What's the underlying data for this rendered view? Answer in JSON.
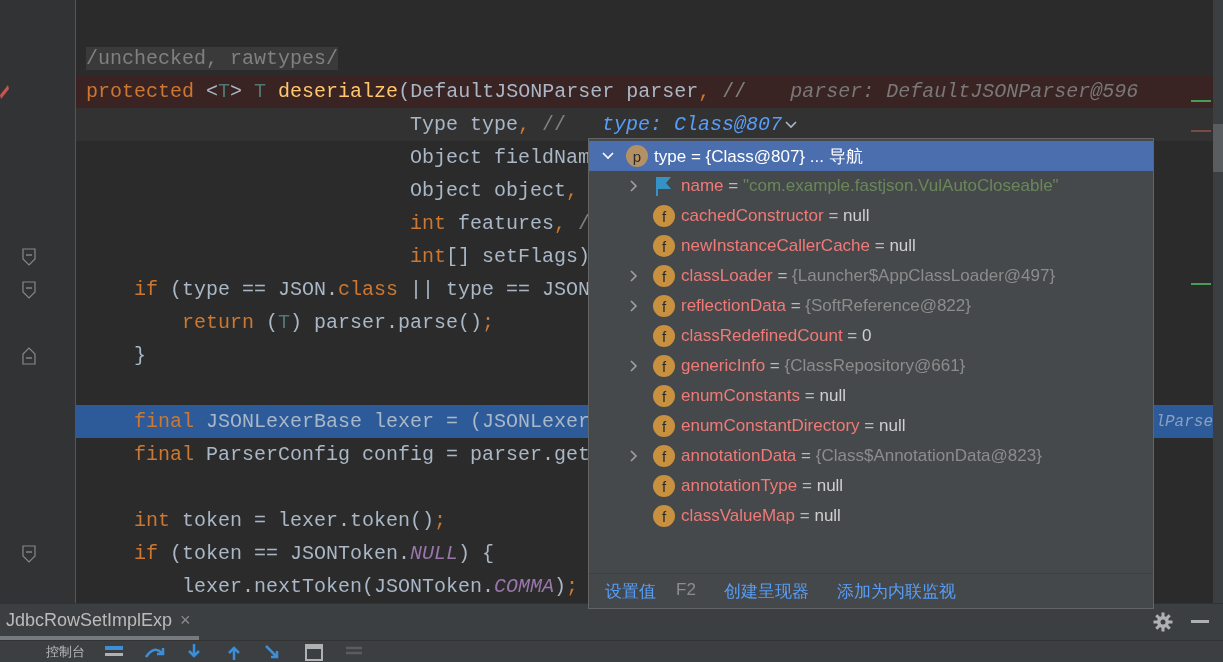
{
  "editor": {
    "gutter": [
      {
        "kind": "none"
      },
      {
        "kind": "breakpoint"
      },
      {
        "kind": "none"
      },
      {
        "kind": "none"
      },
      {
        "kind": "none"
      },
      {
        "kind": "none"
      },
      {
        "kind": "fold-start"
      },
      {
        "kind": "fold-start"
      },
      {
        "kind": "none"
      },
      {
        "kind": "fold-end"
      },
      {
        "kind": "none"
      },
      {
        "kind": "none"
      },
      {
        "kind": "none"
      },
      {
        "kind": "none"
      },
      {
        "kind": "none"
      },
      {
        "kind": "fold-start"
      },
      {
        "kind": "none"
      }
    ],
    "lines": [
      {
        "kind": "annotation",
        "tokens": [
          {
            "kind": "comment",
            "t": "/unchecked, rawtypes/"
          }
        ]
      },
      {
        "kind": "breakpoint",
        "tokens": [
          {
            "kind": "kw",
            "t": "protected"
          },
          {
            "kind": "plain",
            "t": " <"
          },
          {
            "kind": "tp",
            "t": "T"
          },
          {
            "kind": "plain",
            "t": "> "
          },
          {
            "kind": "tp",
            "t": "T"
          },
          {
            "kind": "fn",
            "t": " deserialze"
          },
          {
            "kind": "plain",
            "t": "(DefaultJSONParser parser"
          },
          {
            "kind": "punct",
            "t": ","
          },
          {
            "kind": "comment",
            "t": " //"
          }
        ],
        "hint": {
          "kind": "inline",
          "text": "parser: DefaultJSONParser@596"
        }
      },
      {
        "kind": "param-current",
        "tokens": [
          {
            "kind": "plain",
            "t": "Type type"
          },
          {
            "kind": "punct",
            "t": ","
          },
          {
            "kind": "comment",
            "t": " //"
          }
        ],
        "hint": {
          "kind": "dropdown",
          "text": "type: Class@807"
        }
      },
      {
        "kind": "param",
        "tokens": [
          {
            "kind": "plain",
            "t": "Object fieldNam"
          }
        ]
      },
      {
        "kind": "param",
        "tokens": [
          {
            "kind": "plain",
            "t": "Object object"
          },
          {
            "kind": "punct",
            "t": ","
          }
        ]
      },
      {
        "kind": "param",
        "tokens": [
          {
            "kind": "kw",
            "t": "int"
          },
          {
            "kind": "plain",
            "t": " features"
          },
          {
            "kind": "punct",
            "t": ","
          },
          {
            "kind": "comment",
            "t": " /"
          }
        ]
      },
      {
        "kind": "param",
        "tokens": [
          {
            "kind": "kw",
            "t": "int"
          },
          {
            "kind": "plain",
            "t": "[] setFlags)"
          }
        ]
      },
      {
        "kind": "block",
        "tokens": [
          {
            "kind": "kw",
            "t": "if"
          },
          {
            "kind": "plain",
            "t": " (type == JSON."
          },
          {
            "kind": "kw",
            "t": "class"
          },
          {
            "kind": "plain",
            "t": " || type == JSON"
          }
        ]
      },
      {
        "kind": "nested",
        "tokens": [
          {
            "kind": "kw",
            "t": "return"
          },
          {
            "kind": "plain",
            "t": " ("
          },
          {
            "kind": "tp",
            "t": "T"
          },
          {
            "kind": "plain",
            "t": ") parser.parse()"
          },
          {
            "kind": "punct",
            "t": ";"
          }
        ]
      },
      {
        "kind": "block",
        "tokens": [
          {
            "kind": "plain",
            "t": "}"
          }
        ]
      },
      {
        "kind": "block"
      },
      {
        "kind": "block-execution",
        "tokens": [
          {
            "kind": "kw",
            "t": "final"
          },
          {
            "kind": "plain",
            "t": " JSONLexerBase lexer = (JSONLexer"
          }
        ],
        "tail": "lParse"
      },
      {
        "kind": "block",
        "tokens": [
          {
            "kind": "kw",
            "t": "final"
          },
          {
            "kind": "plain",
            "t": " ParserConfig config = parser.get"
          }
        ]
      },
      {
        "kind": "block"
      },
      {
        "kind": "block",
        "tokens": [
          {
            "kind": "kw",
            "t": "int"
          },
          {
            "kind": "plain",
            "t": " token = lexer.token()"
          },
          {
            "kind": "punct",
            "t": ";"
          }
        ]
      },
      {
        "kind": "block",
        "tokens": [
          {
            "kind": "kw",
            "t": "if"
          },
          {
            "kind": "plain",
            "t": " (token == JSONToken."
          },
          {
            "kind": "const",
            "t": "NULL"
          },
          {
            "kind": "plain",
            "t": ") {"
          }
        ]
      },
      {
        "kind": "nested",
        "tokens": [
          {
            "kind": "plain",
            "t": "lexer.nextToken(JSONToken."
          },
          {
            "kind": "const",
            "t": "COMMA"
          },
          {
            "kind": "plain",
            "t": ")"
          },
          {
            "kind": "punct",
            "t": ";"
          }
        ]
      }
    ]
  },
  "popup": {
    "header": {
      "expanded": true,
      "selected": true,
      "badge": "p",
      "name": "type",
      "op": "=",
      "value": "{Class@807}",
      "suffix": "... 导航"
    },
    "rows": [
      {
        "expandable": true,
        "kind": "string",
        "icon": {
          "kind": "flag"
        },
        "name": "name",
        "op": "=",
        "value": "\"com.example.fastjson.VulAutoCloseable\""
      },
      {
        "expandable": false,
        "kind": "plain",
        "icon": {
          "kind": "letter",
          "letter": "f"
        },
        "name": "cachedConstructor",
        "op": "=",
        "value": "null"
      },
      {
        "expandable": false,
        "kind": "plain",
        "icon": {
          "kind": "letter",
          "letter": "f"
        },
        "name": "newInstanceCallerCache",
        "op": "=",
        "value": "null"
      },
      {
        "expandable": true,
        "kind": "object",
        "icon": {
          "kind": "letter",
          "letter": "f"
        },
        "name": "classLoader",
        "op": "=",
        "value": "{Launcher$AppClassLoader@497}"
      },
      {
        "expandable": true,
        "kind": "object",
        "icon": {
          "kind": "letter",
          "letter": "f"
        },
        "name": "reflectionData",
        "op": "=",
        "value": "{SoftReference@822}"
      },
      {
        "expandable": false,
        "kind": "plain",
        "icon": {
          "kind": "letter",
          "letter": "f"
        },
        "name": "classRedefinedCount",
        "op": "=",
        "value": "0"
      },
      {
        "expandable": true,
        "kind": "object",
        "icon": {
          "kind": "letter",
          "letter": "f"
        },
        "name": "genericInfo",
        "op": "=",
        "value": "{ClassRepository@661}"
      },
      {
        "expandable": false,
        "kind": "plain",
        "icon": {
          "kind": "letter",
          "letter": "f"
        },
        "name": "enumConstants",
        "op": "=",
        "value": "null"
      },
      {
        "expandable": false,
        "kind": "plain",
        "icon": {
          "kind": "letter",
          "letter": "f"
        },
        "name": "enumConstantDirectory",
        "op": "=",
        "value": "null"
      },
      {
        "expandable": true,
        "kind": "object",
        "icon": {
          "kind": "letter",
          "letter": "f"
        },
        "name": "annotationData",
        "op": "=",
        "value": "{Class$AnnotationData@823}"
      },
      {
        "expandable": false,
        "kind": "plain",
        "icon": {
          "kind": "letter",
          "letter": "f"
        },
        "name": "annotationType",
        "op": "=",
        "value": "null"
      },
      {
        "expandable": false,
        "kind": "plain",
        "icon": {
          "kind": "letter",
          "letter": "f"
        },
        "name": "classValueMap",
        "op": "=",
        "value": "null"
      }
    ],
    "actions": [
      {
        "label": "设置值",
        "shortcut": "F2"
      },
      {
        "label": "创建呈现器"
      },
      {
        "label": "添加为内联监视"
      }
    ]
  },
  "bottom_panel": {
    "tabs": [
      {
        "label": "JdbcRowSetImplExp",
        "selected": true,
        "close": "×"
      }
    ],
    "toolbar": {
      "label": "控制台"
    }
  }
}
